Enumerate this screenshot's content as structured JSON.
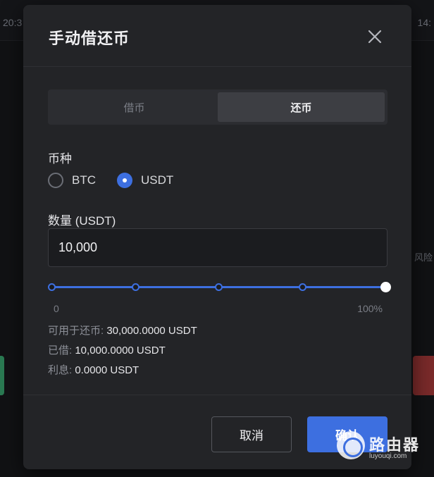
{
  "background": {
    "time_text": "20:3",
    "right_text": "14:",
    "side_label": "风险"
  },
  "modal": {
    "title": "手动借还币",
    "tabs": [
      {
        "label": "借币",
        "active": false
      },
      {
        "label": "还币",
        "active": true
      }
    ],
    "currency_label": "币种",
    "currency_options": [
      {
        "label": "BTC",
        "selected": false
      },
      {
        "label": "USDT",
        "selected": true
      }
    ],
    "amount_label": "数量 (USDT)",
    "amount_value": "10,000",
    "slider": {
      "min_label": "0",
      "max_label": "100%",
      "value_percent": 100,
      "steps": [
        0,
        25,
        50,
        75
      ]
    },
    "info": [
      {
        "key": "可用于还币:",
        "value": "30,000.0000 USDT"
      },
      {
        "key": "已借:",
        "value": "10,000.0000 USDT"
      },
      {
        "key": "利息:",
        "value": "0.0000 USDT"
      }
    ],
    "cancel_label": "取消",
    "confirm_label": "确认"
  },
  "colors": {
    "accent": "#3d6fe0",
    "modal_bg": "#232427",
    "page_bg": "#111214"
  },
  "watermark": {
    "text": "路由器",
    "url": "luyouqi.com"
  }
}
